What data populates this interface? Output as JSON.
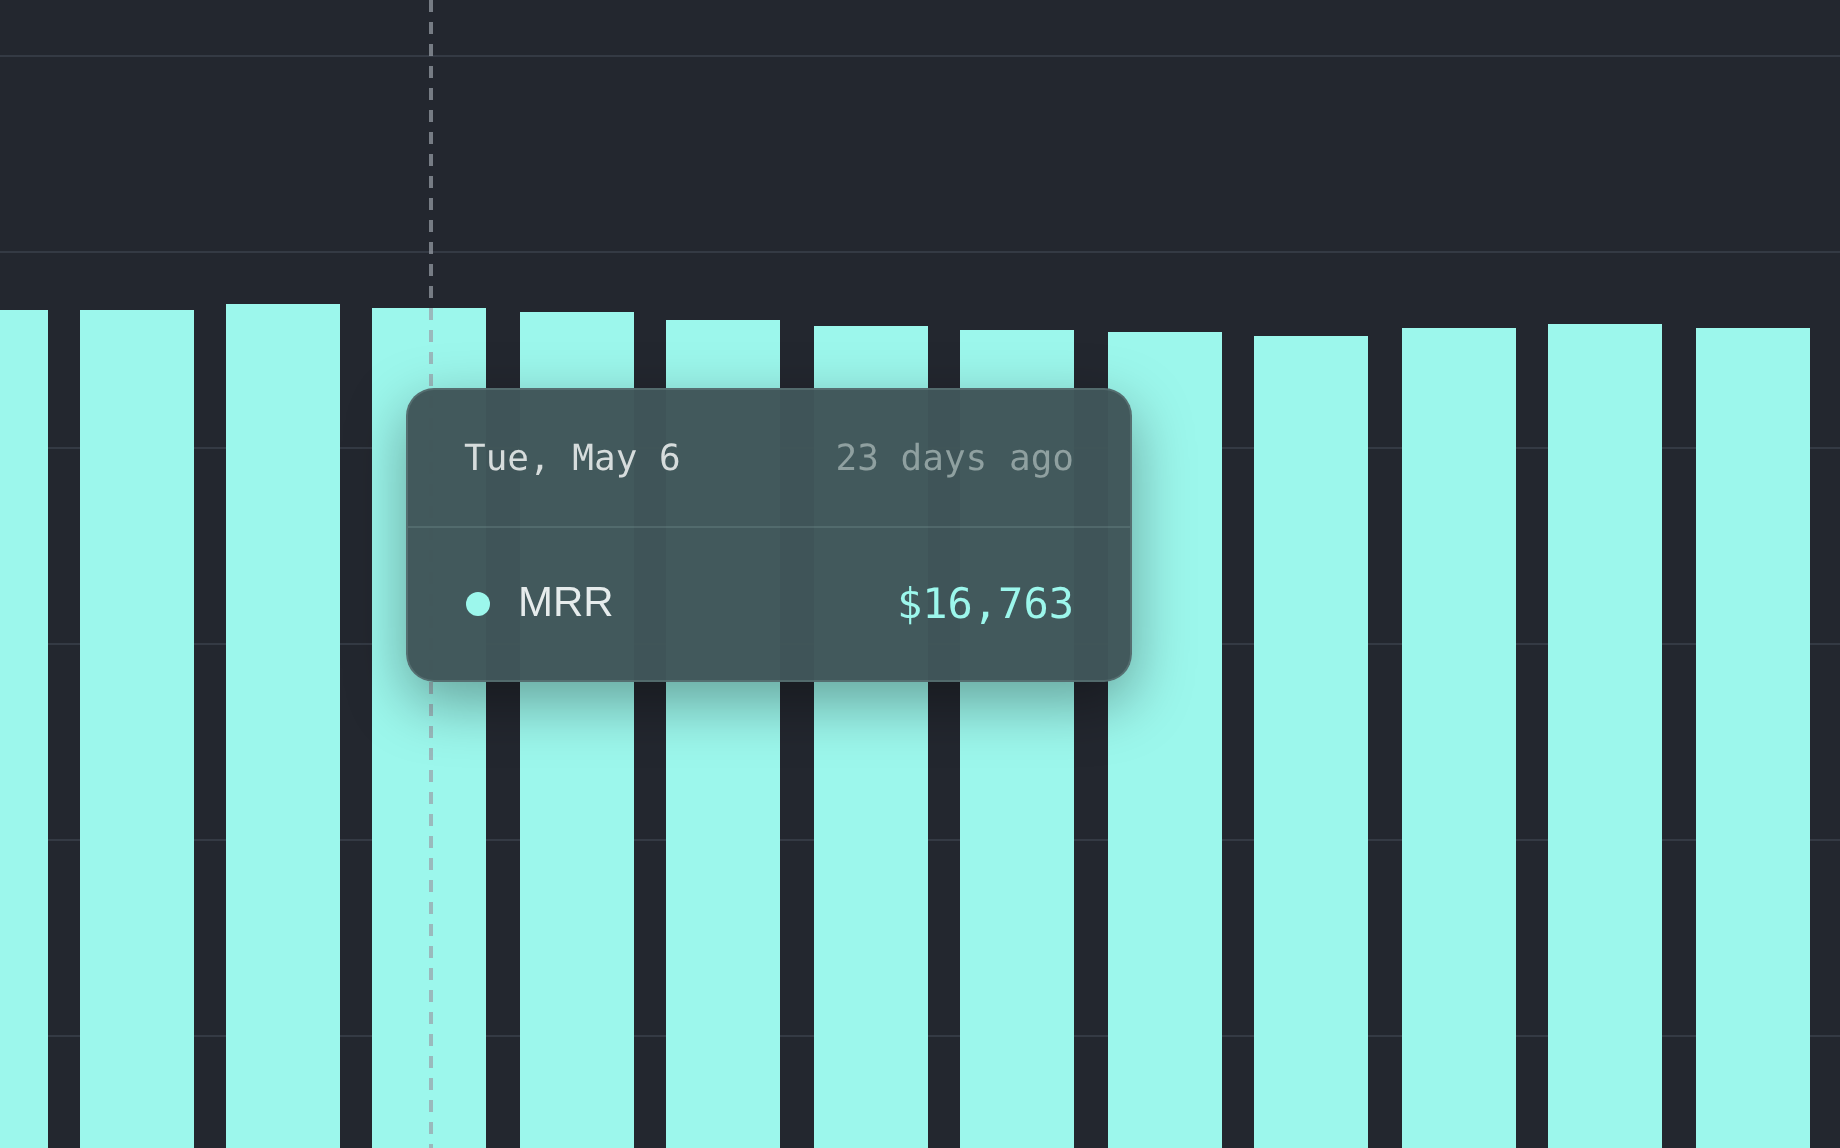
{
  "tooltip": {
    "date": "Tue, May 6",
    "relative_time": "23 days ago",
    "series": [
      {
        "name": "MRR",
        "value": "$16,763"
      }
    ]
  }
}
